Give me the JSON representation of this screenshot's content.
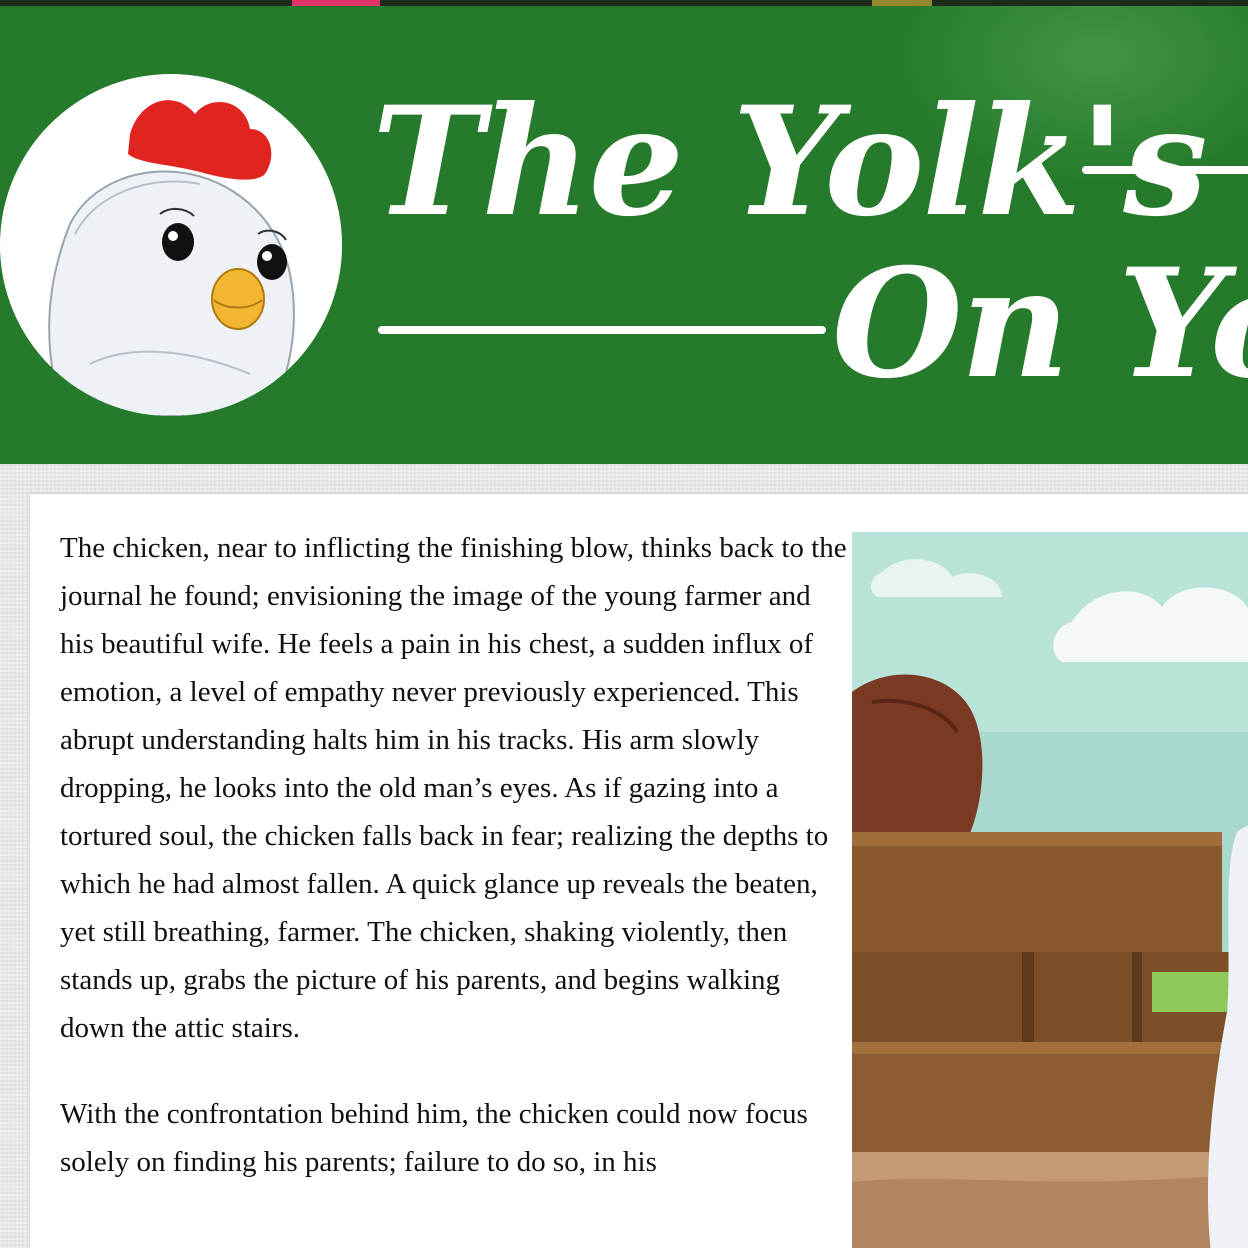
{
  "header": {
    "title_line_1": "The Yolk's",
    "title_line_2": "On Yo",
    "logo_name": "chicken-mascot-logo"
  },
  "article": {
    "paragraphs": [
      "The chicken, near to inflicting the finishing blow, thinks back to the journal he found; envisioning the image of the young farmer and his beautiful wife. He feels a pain in his chest, a sudden influx of emotion, a level of empathy never previously experienced. This abrupt understanding halts him in his tracks. His arm slowly dropping, he looks into the old man’s eyes. As if gazing into a tortured soul, the chicken falls back in fear; realizing the depths to which he had almost fallen. A quick glance up reveals the beaten, yet still breathing, farmer. The chicken, shaking violently, then stands up, grabs the picture of his parents, and begins walking down the attic stairs.",
      "With the confrontation behind him, the chicken could now focus solely on finding his parents; failure to do so, in his"
    ]
  },
  "colors": {
    "header_green": "#267a2b",
    "comb_red": "#e0241f",
    "beak_yellow": "#f2b632",
    "accent_pink": "#e0356a"
  },
  "illustration": {
    "icon": "story-illustration-farm-scene"
  }
}
